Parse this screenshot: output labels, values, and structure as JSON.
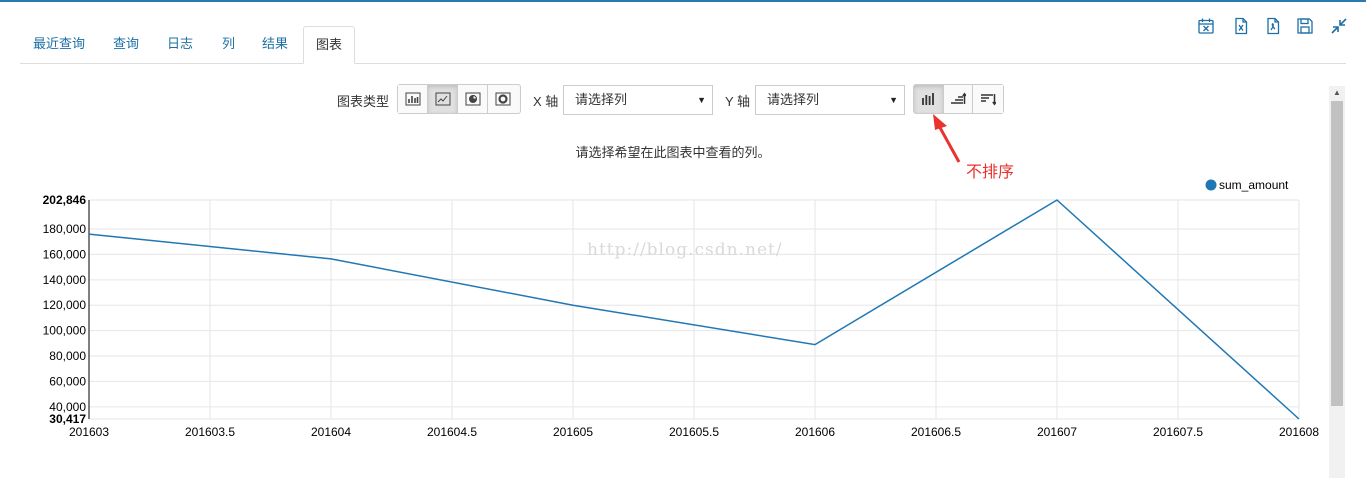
{
  "tabs": [
    {
      "label": "最近查询"
    },
    {
      "label": "查询"
    },
    {
      "label": "日志"
    },
    {
      "label": "列"
    },
    {
      "label": "结果"
    },
    {
      "label": "图表"
    }
  ],
  "toolbar": {
    "chart_type_label": "图表类型",
    "x_axis_label": "X 轴",
    "y_axis_label": "Y 轴",
    "x_select": {
      "value": "请选择列"
    },
    "y_select": {
      "value": "请选择列"
    }
  },
  "hint": "请选择希望在此图表中查看的列。",
  "annotation": "不排序",
  "watermark": "http://blog.csdn.net/",
  "colors": {
    "accent": "#1d6fa5",
    "series": "#1f77b4",
    "annotation": "#e8332e"
  },
  "chart_data": {
    "type": "line",
    "title": "",
    "xlabel": "",
    "ylabel": "",
    "x_ticks": [
      "201603",
      "201603.5",
      "201604",
      "201604.5",
      "201605",
      "201605.5",
      "201606",
      "201606.5",
      "201607",
      "201607.5",
      "201608"
    ],
    "y_ticks": [
      "30,417",
      "40,000",
      "60,000",
      "80,000",
      "100,000",
      "120,000",
      "140,000",
      "160,000",
      "180,000",
      "202,846"
    ],
    "y_tick_values": [
      30417,
      40000,
      60000,
      80000,
      100000,
      120000,
      140000,
      160000,
      180000,
      202846
    ],
    "ylim": [
      30417,
      202846
    ],
    "xlim": [
      201603,
      201608
    ],
    "grid": true,
    "legend_position": "top-right",
    "series": [
      {
        "name": "sum_amount",
        "x": [
          201603,
          201604,
          201605,
          201606,
          201607,
          201608
        ],
        "values": [
          176000,
          156500,
          120000,
          89000,
          202846,
          30417
        ]
      }
    ]
  }
}
